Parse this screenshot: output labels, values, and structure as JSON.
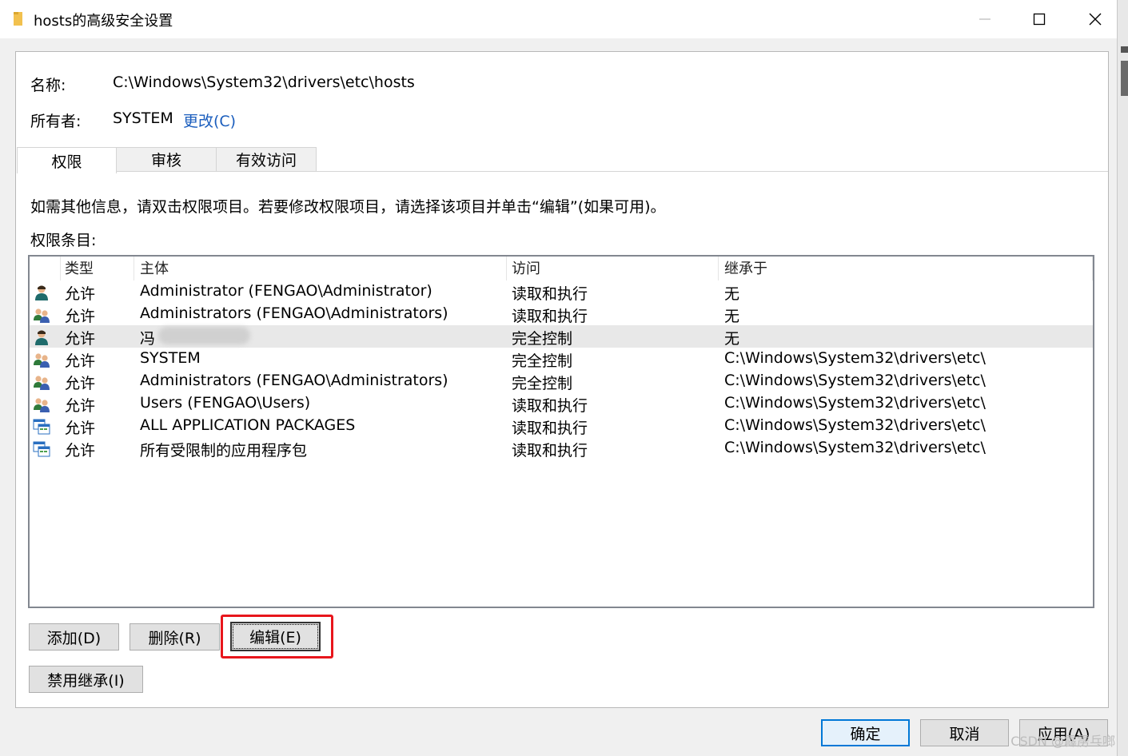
{
  "window": {
    "title": "hosts的高级安全设置",
    "minimize_icon": "minimize-icon",
    "maximize_icon": "maximize-icon",
    "close_icon": "close-icon"
  },
  "info": {
    "name_label": "名称:",
    "name_value": "C:\\Windows\\System32\\drivers\\etc\\hosts",
    "owner_label": "所有者:",
    "owner_value": "SYSTEM",
    "change_link": "更改(C)"
  },
  "tabs": [
    {
      "label": "权限",
      "active": true
    },
    {
      "label": "审核",
      "active": false
    },
    {
      "label": "有效访问",
      "active": false
    }
  ],
  "instructions": "如需其他信息，请双击权限项目。若要修改权限项目，请选择该项目并单击“编辑”(如果可用)。",
  "entries_label": "权限条目:",
  "table": {
    "columns": [
      "类型",
      "主体",
      "访问",
      "继承于"
    ],
    "rows": [
      {
        "icon": "user-icon",
        "type": "允许",
        "principal": "Administrator (FENGAO\\Administrator)",
        "access": "读取和执行",
        "inherited": "无"
      },
      {
        "icon": "group-icon",
        "type": "允许",
        "principal": "Administrators (FENGAO\\Administrators)",
        "access": "读取和执行",
        "inherited": "无"
      },
      {
        "icon": "user-icon",
        "type": "允许",
        "principal": "冯",
        "access": "完全控制",
        "inherited": "无"
      },
      {
        "icon": "group-icon",
        "type": "允许",
        "principal": "SYSTEM",
        "access": "完全控制",
        "inherited": "C:\\Windows\\System32\\drivers\\etc\\"
      },
      {
        "icon": "group-icon",
        "type": "允许",
        "principal": "Administrators (FENGAO\\Administrators)",
        "access": "完全控制",
        "inherited": "C:\\Windows\\System32\\drivers\\etc\\"
      },
      {
        "icon": "group-icon",
        "type": "允许",
        "principal": "Users (FENGAO\\Users)",
        "access": "读取和执行",
        "inherited": "C:\\Windows\\System32\\drivers\\etc\\"
      },
      {
        "icon": "app-package-icon",
        "type": "允许",
        "principal": "ALL APPLICATION PACKAGES",
        "access": "读取和执行",
        "inherited": "C:\\Windows\\System32\\drivers\\etc\\"
      },
      {
        "icon": "app-package-icon",
        "type": "允许",
        "principal": "所有受限制的应用程序包",
        "access": "读取和执行",
        "inherited": "C:\\Windows\\System32\\drivers\\etc\\"
      }
    ]
  },
  "buttons": {
    "add": "添加(D)",
    "remove": "删除(R)",
    "edit": "编辑(E)",
    "disable_inheritance": "禁用继承(I)",
    "ok": "确定",
    "cancel": "取消",
    "apply": "应用(A)"
  },
  "watermark": "CSDN @霹雳乓啷",
  "colors": {
    "link": "#1a5dbd",
    "highlight_box": "#e8161c",
    "default_button_border": "#0078d7"
  }
}
